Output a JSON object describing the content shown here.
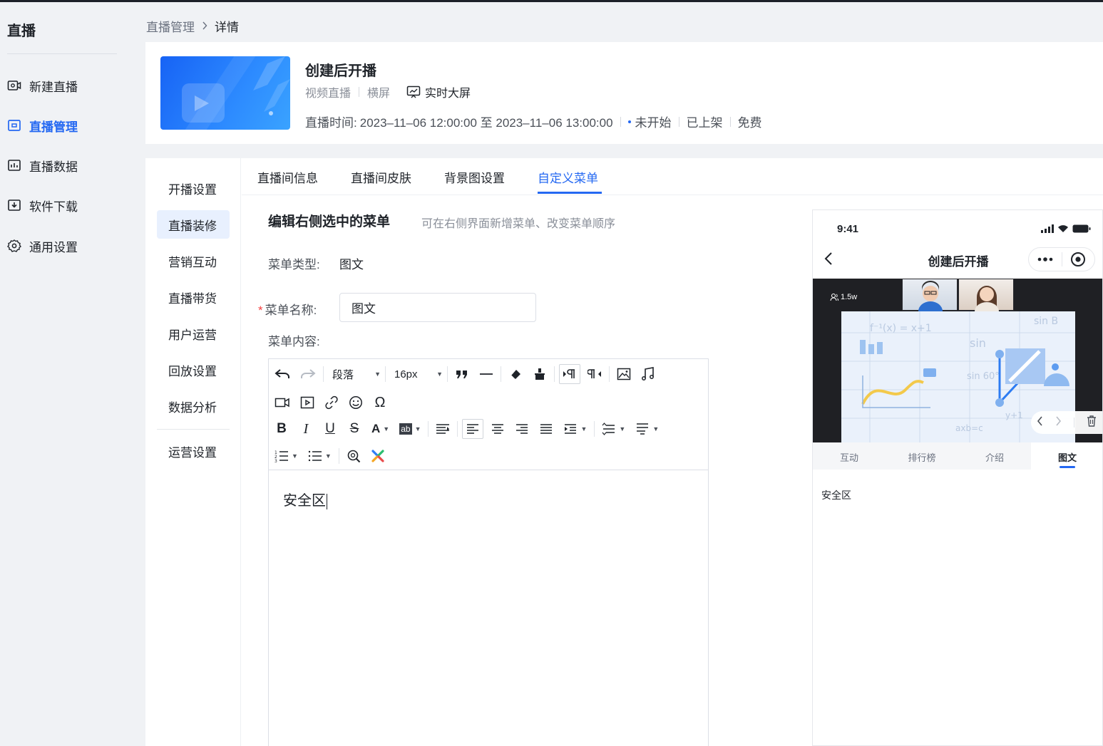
{
  "sidebar": {
    "brand": "直播",
    "items": [
      {
        "label": "新建直播",
        "icon": "camera-icon"
      },
      {
        "label": "直播管理",
        "icon": "monitor-icon"
      },
      {
        "label": "直播数据",
        "icon": "chart-icon"
      },
      {
        "label": "软件下载",
        "icon": "download-icon"
      },
      {
        "label": "通用设置",
        "icon": "gear-icon"
      }
    ],
    "active_index": 1
  },
  "breadcrumb": {
    "parent": "直播管理",
    "separator": ">",
    "current": "详情"
  },
  "live": {
    "title": "创建后开播",
    "type": "视频直播",
    "orientation": "横屏",
    "screen_link": "实时大屏",
    "time_label": "直播时间:",
    "time_range": "2023–11–06 12:00:00 至 2023–11–06 13:00:00",
    "status": "未开始",
    "shelf": "已上架",
    "price": "免费"
  },
  "subnav": {
    "items": [
      "开播设置",
      "直播装修",
      "营销互动",
      "直播带货",
      "用户运营",
      "回放设置",
      "数据分析",
      "运营设置"
    ],
    "active_index": 1
  },
  "tabs": {
    "items": [
      "直播间信息",
      "直播间皮肤",
      "背景图设置",
      "自定义菜单"
    ],
    "active_index": 3
  },
  "form": {
    "title": "编辑右侧选中的菜单",
    "hint": "可在右侧界面新增菜单、改变菜单顺序",
    "type_label": "菜单类型:",
    "type_value": "图文",
    "required_mark": "*",
    "name_label": "菜单名称:",
    "name_value": "图文",
    "content_label": "菜单内容:"
  },
  "editor": {
    "paragraph_select": "段落",
    "font_size_select": "16px",
    "content": "安全区"
  },
  "preview": {
    "time": "9:41",
    "title": "创建后开播",
    "viewers": "1.5w",
    "tabs": [
      "互动",
      "排行榜",
      "介绍",
      "图文"
    ],
    "active_tab": 3,
    "content": "安全区"
  },
  "colors": {
    "accent": "#2468f2",
    "required": "#f53f3f"
  }
}
